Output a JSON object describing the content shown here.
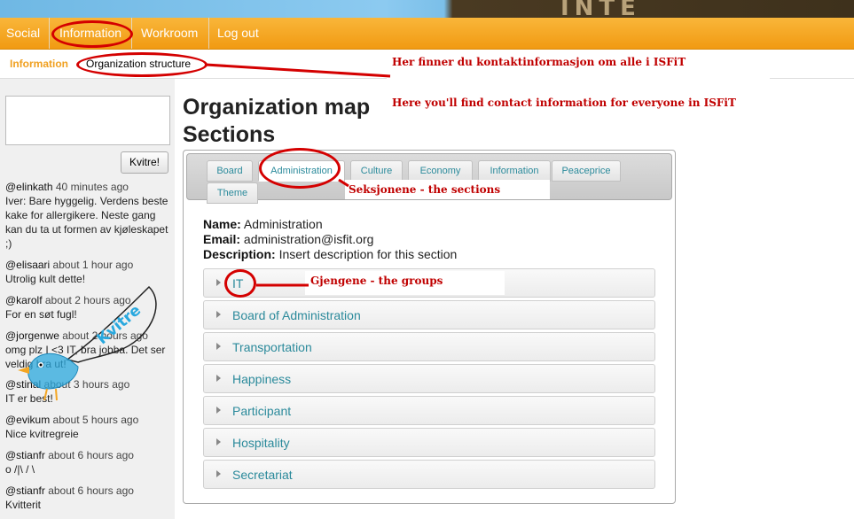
{
  "banner": {
    "art_text": "INTE"
  },
  "main_nav": {
    "items": [
      "Social",
      "Information",
      "Workroom",
      "Log out"
    ]
  },
  "sub_nav": {
    "items": [
      "Information",
      "Organization structure"
    ]
  },
  "annotations": {
    "line1": "Her finner du kontaktinformasjon om alle i ISFiT",
    "line2": "Here you'll find contact information for everyone in ISFiT",
    "sections": "Seksjonene - the sections",
    "groups": "Gjengene - the groups"
  },
  "sidebar": {
    "tweet_button": "Kvitre!",
    "bird_label": "Kvitre",
    "tweets": [
      {
        "user": "@elinkath",
        "time": " 40 minutes ago",
        "text": "Iver: Bare hyggelig. Verdens beste kake for allergikere. Neste gang kan du ta ut formen av kjøleskapet ;)"
      },
      {
        "user": "@elisaari",
        "time": " about 1 hour ago",
        "text": "Utrolig kult dette!"
      },
      {
        "user": "@karolf",
        "time": " about 2 hours ago",
        "text": "For en søt fugl!"
      },
      {
        "user": "@jorgenwe",
        "time": " about 2 hours ago",
        "text": "omg plz I <3 IT, bra jobba. Det ser veldig bra ut!"
      },
      {
        "user": "@stinal",
        "time": " about 3 hours ago",
        "text": "IT er best!"
      },
      {
        "user": "@evikum",
        "time": " about 5 hours ago",
        "text": "Nice kvitregreie"
      },
      {
        "user": "@stianfr",
        "time": " about 6 hours ago",
        "text": "o /|\\ / \\"
      },
      {
        "user": "@stianfr",
        "time": " about 6 hours ago",
        "text": "Kvitterit"
      }
    ]
  },
  "page": {
    "title": "Organization map",
    "subtitle": "Sections"
  },
  "tabs": [
    "Board",
    "Administration",
    "Culture",
    "Economy",
    "Information",
    "Peaceprice",
    "Theme"
  ],
  "active_tab": "Administration",
  "section_info": {
    "name_label": "Name:",
    "name": " Administration",
    "email_label": "Email:",
    "email": " administration@isfit.org",
    "desc_label": "Description:",
    "desc": " Insert description for this section"
  },
  "groups": [
    "IT",
    "Board of Administration",
    "Transportation",
    "Happiness",
    "Participant",
    "Hospitality",
    "Secretariat"
  ],
  "colors": {
    "nav_orange": "#f19a12",
    "annotation_red": "#c00000",
    "link_teal": "#2b8a9b"
  }
}
